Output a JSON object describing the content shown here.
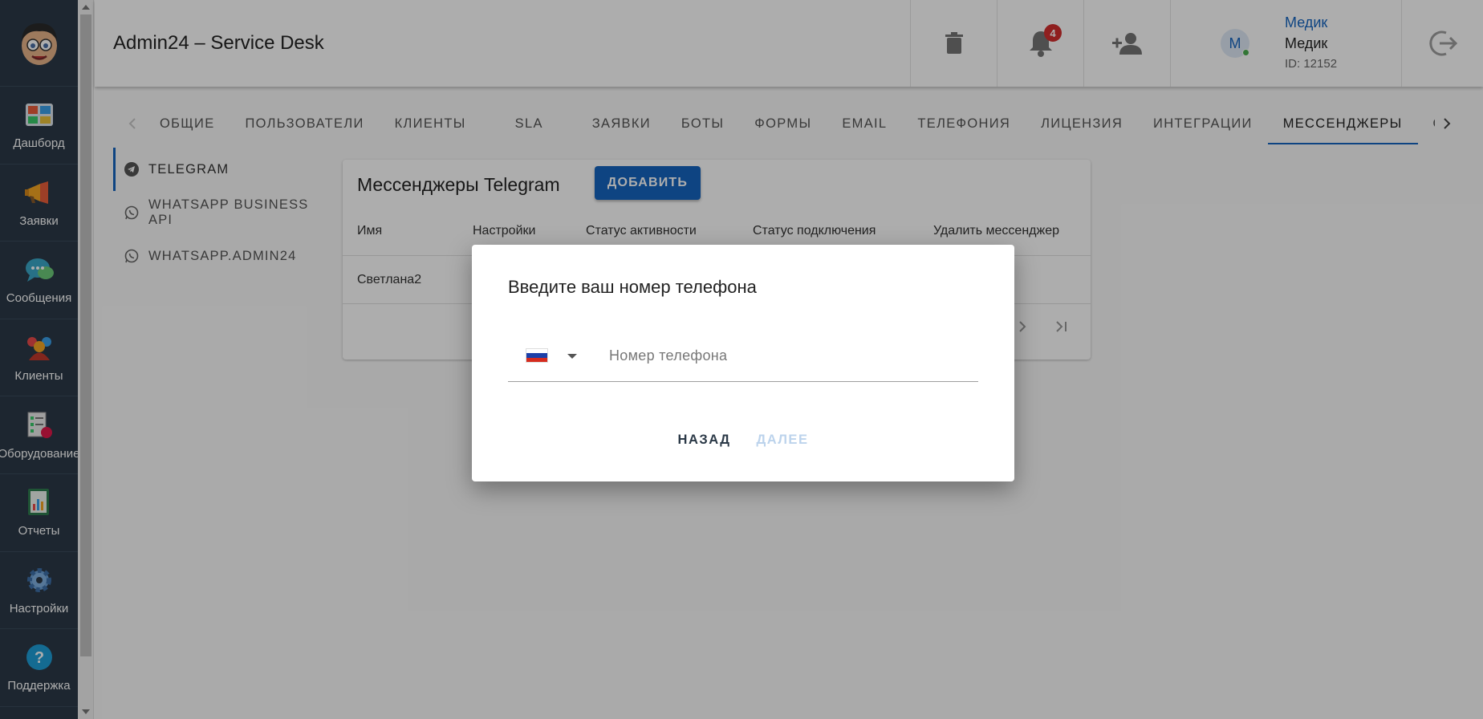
{
  "rail": {
    "items": [
      {
        "label": "Дашборд",
        "icon": "dashboard-icon"
      },
      {
        "label": "Заявки",
        "icon": "megaphone-icon"
      },
      {
        "label": "Сообщения",
        "icon": "chat-icon"
      },
      {
        "label": "Клиенты",
        "icon": "clients-icon"
      },
      {
        "label": "Оборудование",
        "icon": "equipment-icon"
      },
      {
        "label": "Отчеты",
        "icon": "reports-icon"
      },
      {
        "label": "Настройки",
        "icon": "gear-icon"
      },
      {
        "label": "Поддержка",
        "icon": "help-icon"
      }
    ]
  },
  "header": {
    "title": "Admin24 – Service Desk",
    "notifications_count": "4",
    "user": {
      "initial": "M",
      "link": "Медик",
      "name": "Медик",
      "id": "ID: 12152"
    }
  },
  "tabs": [
    "ОБЩИЕ",
    "ПОЛЬЗОВАТЕЛИ",
    "КЛИЕНТЫ",
    "SLA",
    "ЗАЯВКИ",
    "БОТЫ",
    "ФОРМЫ",
    "EMAIL",
    "ТЕЛЕФОНИЯ",
    "ЛИЦЕНЗИЯ",
    "ИНТЕГРАЦИИ",
    "МЕССЕНДЖЕРЫ",
    "ОТКР"
  ],
  "subnav": [
    "TELEGRAM",
    "WHATSAPP BUSINESS API",
    "WHATSAPP.ADMIN24"
  ],
  "card": {
    "title": "Мессенджеры Telegram",
    "add_label": "ДОБАВИТЬ",
    "columns": [
      "Имя",
      "Настройки",
      "Статус активности",
      "Статус подключения",
      "Удалить мессенджер"
    ],
    "rows": [
      [
        "Светлана2"
      ]
    ]
  },
  "dialog": {
    "title": "Введите ваш номер телефона",
    "phone_placeholder": "Номер телефона",
    "phone_value": "",
    "back_label": "НАЗАД",
    "next_label": "ДАЛЕЕ"
  },
  "colors": {
    "accent": "#1565c0",
    "rail_bg": "#2b3947",
    "badge": "#d32f2f",
    "online": "#4caf50",
    "disabled": "#bcd3ec"
  }
}
